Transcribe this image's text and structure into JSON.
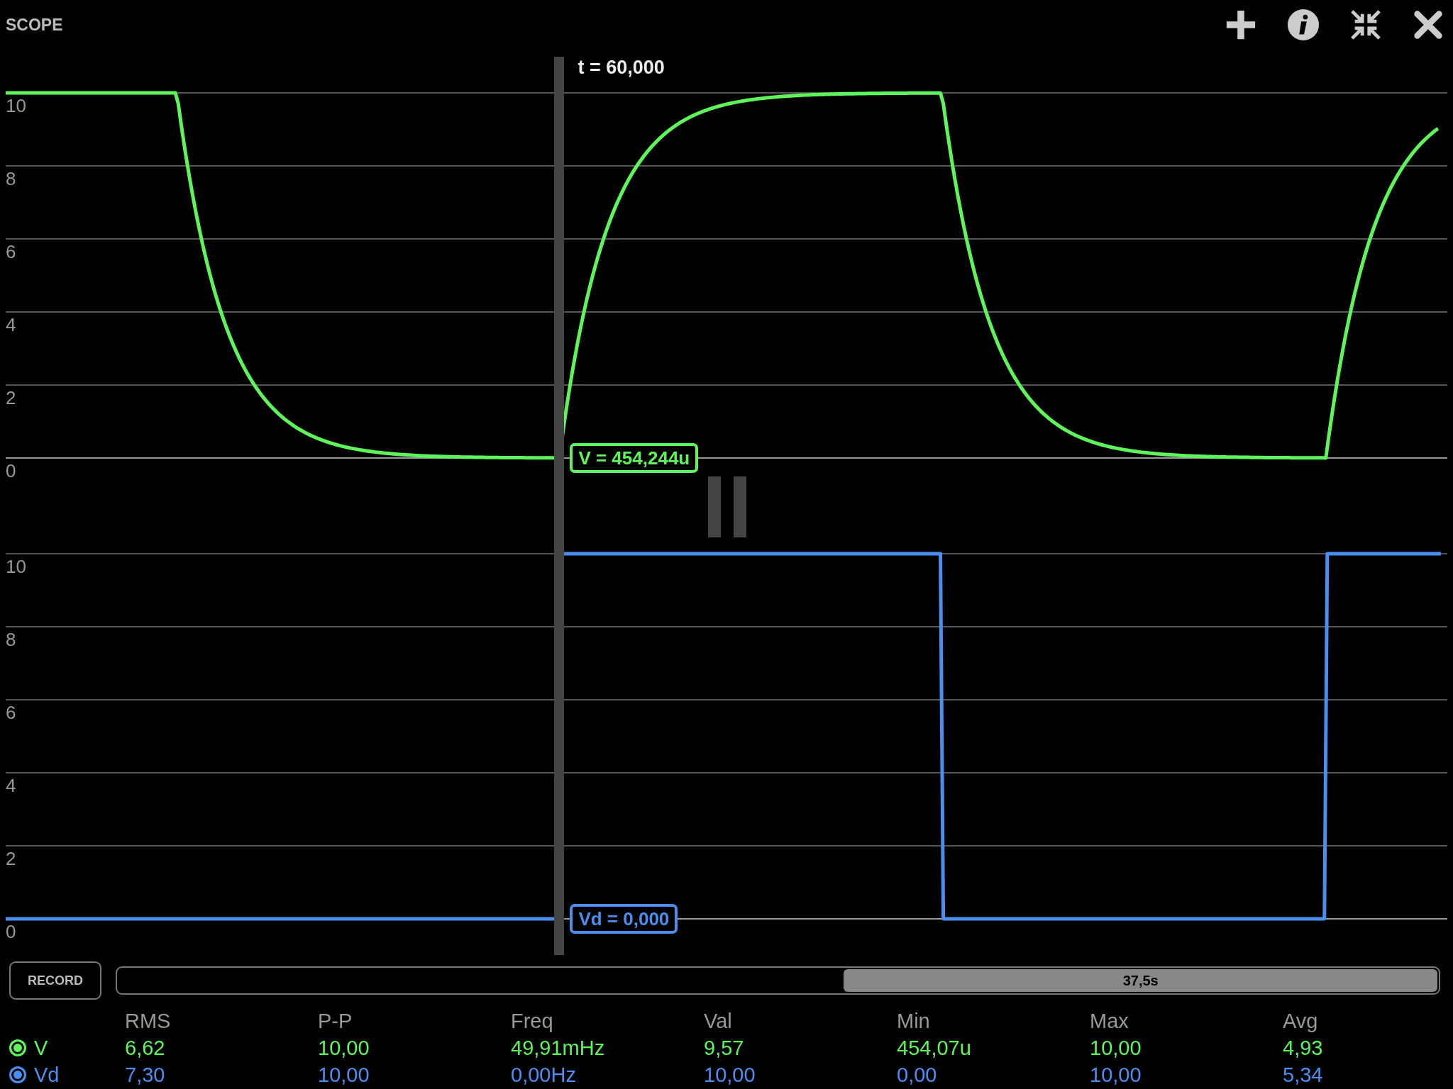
{
  "title": "SCOPE",
  "cursor": {
    "label": "t = 60,000"
  },
  "paused": true,
  "charts": [
    {
      "kind": "smooth",
      "color": "#5ef55a",
      "y_labels": [
        "10",
        "8",
        "6",
        "4",
        "2",
        "0"
      ],
      "readout": "V = 454,244u"
    },
    {
      "kind": "square",
      "color": "#4a8ef0",
      "y_labels": [
        "10",
        "8",
        "6",
        "4",
        "2",
        "0"
      ],
      "readout": "Vd = 0,000"
    }
  ],
  "record": {
    "label": "RECORD"
  },
  "buffer": {
    "label": "37,5s",
    "level": 0.45
  },
  "stats": {
    "columns": [
      "RMS",
      "P-P",
      "Freq",
      "Val",
      "Min",
      "Max",
      "Avg"
    ],
    "rows": [
      {
        "name": "V",
        "color": "#5ef55a",
        "values": [
          "6,62",
          "10,00",
          "49,91mHz",
          "9,57",
          "454,07u",
          "10,00",
          "4,93"
        ]
      },
      {
        "name": "Vd",
        "color": "#4a8ef0",
        "values": [
          "7,30",
          "10,00",
          "0,00Hz",
          "10,00",
          "0,00",
          "10,00",
          "5,34"
        ]
      }
    ]
  }
}
